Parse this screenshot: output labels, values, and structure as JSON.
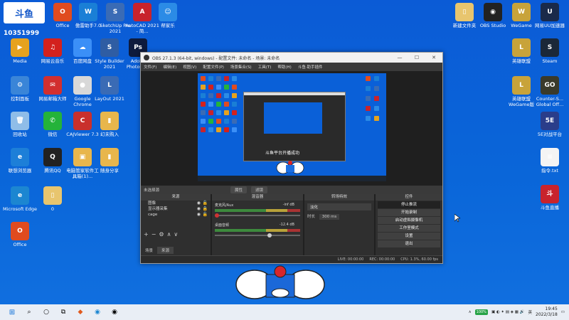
{
  "brand": {
    "logo_text": "斗鱼",
    "sub_text": "DOUYU.COM",
    "room_id": "10351999"
  },
  "desktop_left": [
    {
      "label": "Office",
      "color": "#e04b1f",
      "glyph": "O"
    },
    {
      "label": "傲雷助手7.0",
      "color": "#1a7fd6",
      "glyph": "W"
    },
    {
      "label": "SketchUp Pro 2021",
      "color": "#3a6bb5",
      "glyph": "S"
    },
    {
      "label": "AutoCAD 2021 - 简...",
      "color": "#c8232c",
      "glyph": "A"
    },
    {
      "label": "帮家乐",
      "color": "#2b8be6",
      "glyph": "☺"
    },
    {
      "label": "Media",
      "color": "#e6a21e",
      "glyph": "▶"
    },
    {
      "label": "网易云音乐",
      "color": "#d3211d",
      "glyph": "♫"
    },
    {
      "label": "百度网盘",
      "color": "#3b8ff7",
      "glyph": "☁"
    },
    {
      "label": "Style Builder 2021",
      "color": "#2f5da3",
      "glyph": "S"
    },
    {
      "label": "Adobe Photosh...",
      "color": "#0e1b3d",
      "glyph": "Ps"
    },
    {
      "label": "控制面板",
      "color": "#3a85d8",
      "glyph": "⚙"
    },
    {
      "label": "网易邮箱大师",
      "color": "#d22f2f",
      "glyph": "✉"
    },
    {
      "label": "Google Chrome",
      "color": "#d8d8d8",
      "glyph": "●"
    },
    {
      "label": "LayOut 2021",
      "color": "#3a6bb5",
      "glyph": "L"
    },
    {
      "label": "回收站",
      "color": "#8fbde8",
      "glyph": "🗑"
    },
    {
      "label": "微信",
      "color": "#24b33a",
      "glyph": "✆"
    },
    {
      "label": "CAJViewer 7.3",
      "color": "#c9302c",
      "glyph": "C"
    },
    {
      "label": "幻未购入",
      "color": "#e8b64c",
      "glyph": "▮"
    },
    {
      "label": "联想浏览器",
      "color": "#1d7fd8",
      "glyph": "e"
    },
    {
      "label": "腾讯QQ",
      "color": "#222",
      "glyph": "Q"
    },
    {
      "label": "电脑管家软件工具箱(1)...",
      "color": "#e8b64c",
      "glyph": "▣"
    },
    {
      "label": "随身分享",
      "color": "#e8b64c",
      "glyph": "▮"
    },
    {
      "label": "Microsoft Edge",
      "color": "#1c86d1",
      "glyph": "e"
    },
    {
      "label": "0",
      "color": "#e8c56e",
      "glyph": "▯"
    },
    {
      "label": "Office",
      "color": "#e04b1f",
      "glyph": "O"
    }
  ],
  "desktop_right": [
    {
      "label": "新建文件夹",
      "color": "#e8c56e",
      "glyph": "▯"
    },
    {
      "label": "OBS Studio",
      "color": "#222",
      "glyph": "◉"
    },
    {
      "label": "WeGame",
      "color": "#c8a33a",
      "glyph": "W"
    },
    {
      "label": "网易UU加速器",
      "color": "#1a2a4a",
      "glyph": "U"
    },
    {
      "label": "英雄联盟",
      "color": "#c8a33a",
      "glyph": "L"
    },
    {
      "label": "Steam",
      "color": "#1b2838",
      "glyph": "S"
    },
    {
      "label": "英雄联盟 WeGame版",
      "color": "#c8a33a",
      "glyph": "L"
    },
    {
      "label": "Counter-S... Global Off...",
      "color": "#3a3a2a",
      "glyph": "GO"
    },
    {
      "label": "5E对战平台",
      "color": "#2a3d8a",
      "glyph": "5E"
    },
    {
      "label": "指令.txt",
      "color": "#f4f4f4",
      "glyph": "≡"
    },
    {
      "label": "斗鱼直播",
      "color": "#c8232c",
      "glyph": "斗"
    }
  ],
  "obs": {
    "title": "OBS 27.1.3 (64-bit, windows) - 配置文件: 未命名 - 场景: 未命名",
    "menu": [
      "文件(F)",
      "编辑(E)",
      "视图(V)",
      "配置文件(P)",
      "场景集合(S)",
      "工具(T)",
      "帮助(H)",
      "斗鱼·助手插件"
    ],
    "preview_caption": "斗鱼平台开播成功",
    "scene_bar_label": "未选择源",
    "scene_bar_btn1": "属性",
    "scene_bar_btn2": "滤镜",
    "sources_header": "来源",
    "sources": [
      "图像",
      "显示器采集",
      "cage"
    ],
    "mixer_header": "混音器",
    "mixer": [
      {
        "name": "麦克风/Aux",
        "db": "-inf dB",
        "level": 0
      },
      {
        "name": "桌面音频",
        "db": "-12.4 dB",
        "level": 0.62
      }
    ],
    "transition_header": "转场特效",
    "transition_value": "淡化",
    "duration_label": "时长",
    "duration_value": "300 ms",
    "controls_header": "控件",
    "controls": [
      "停止推流",
      "开始录制",
      "启动虚拟摄像机",
      "工作室模式",
      "设置",
      "退出"
    ],
    "scenes_tab": "场景",
    "sources_tab": "来源",
    "status_live": "LIVE: 00:00:00",
    "status_rec": "REC: 00:00:00",
    "status_cpu": "CPU: 1.3%, 60.00 fps"
  },
  "taskbar": {
    "battery": "100%",
    "lang": "英",
    "time": "19:45",
    "date": "2022/3/18"
  }
}
